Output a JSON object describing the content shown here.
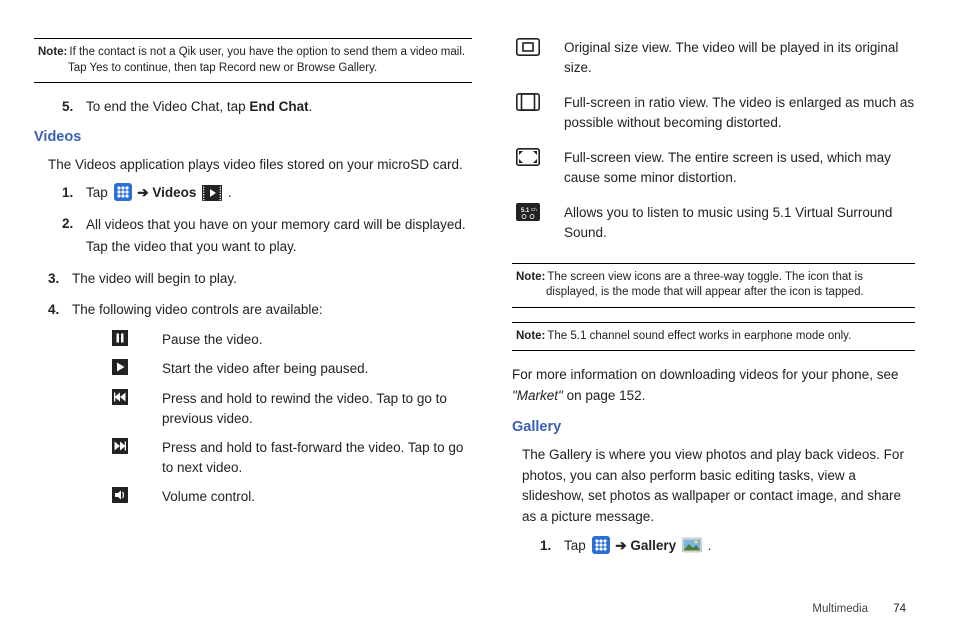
{
  "left": {
    "note1_label": "Note:",
    "note1_text": "If the contact is not a Qik user, you have the option to send them a video mail. Tap Yes to continue, then tap Record new or Browse Gallery.",
    "step5_num": "5.",
    "step5_a": "To end the Video Chat, tap ",
    "step5_b": "End Chat",
    "step5_c": ".",
    "videos_head": "Videos",
    "videos_para": "The Videos application plays video files stored on your microSD card.",
    "vstep1_num": "1.",
    "vstep1_a": "Tap ",
    "vstep1_arrow": " ➔ ",
    "vstep1_b": "Videos",
    "vstep1_c": " .",
    "vstep2_num": "2.",
    "vstep2": "All videos that you have on your memory card will be displayed. Tap the video that you want to play.",
    "vstep3_num": "3.",
    "vstep3": "The video will begin to play.",
    "vstep4_num": "4.",
    "vstep4": "The following video controls are available:",
    "ctrl_pause": "Pause the video.",
    "ctrl_play": "Start the video after being paused.",
    "ctrl_rew": "Press and hold to rewind the video. Tap to go to previous video.",
    "ctrl_ff": "Press and hold to fast-forward the video. Tap to go to next video.",
    "ctrl_vol": "Volume control."
  },
  "right": {
    "r1": "Original size view. The video will be played in its original size.",
    "r2": "Full-screen in ratio view. The video is enlarged as much as possible without becoming distorted.",
    "r3": "Full-screen view. The entire screen is used, which may cause some minor distortion.",
    "r4": "Allows you to listen to music using 5.1 Virtual Surround Sound.",
    "note2_label": "Note:",
    "note2_text": "The screen view icons are a three-way toggle. The icon that is displayed, is the mode that will appear after the icon is tapped.",
    "note3_label": "Note:",
    "note3_text": "The 5.1 channel sound effect works in earphone mode only.",
    "info_a": "For more information on downloading videos for your phone, see ",
    "info_b": "\"Market\"",
    "info_c": " on page 152.",
    "gallery_head": "Gallery",
    "gallery_para": "The Gallery is where you view photos and play back videos. For photos, you can also perform basic editing tasks, view a slideshow, set photos as wallpaper or contact image, and share as a picture message.",
    "gstep1_num": "1.",
    "gstep1_a": "Tap ",
    "gstep1_arrow": " ➔ ",
    "gstep1_b": "Gallery",
    "gstep1_c": " ."
  },
  "footer": {
    "section": "Multimedia",
    "page": "74"
  }
}
